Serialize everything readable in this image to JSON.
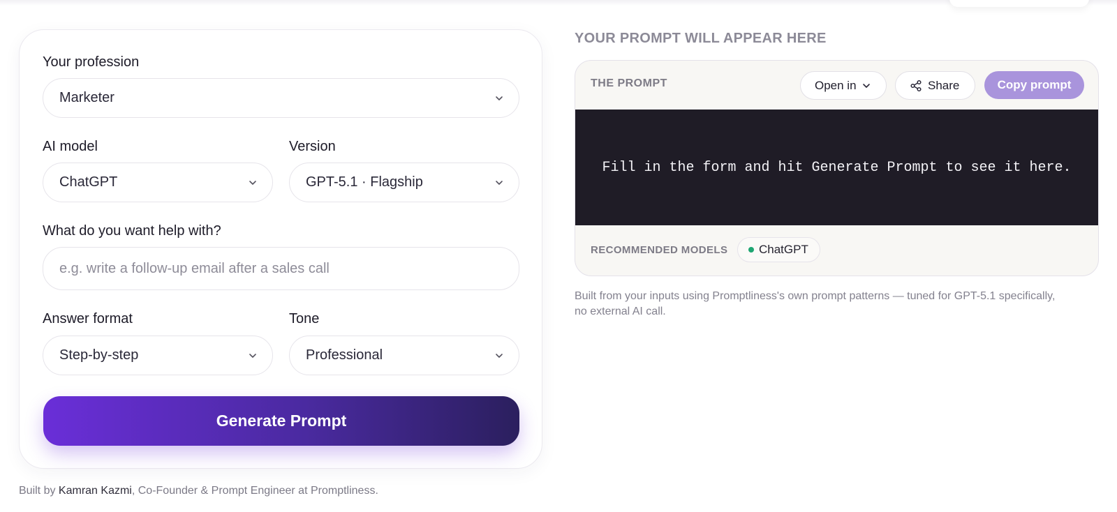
{
  "form": {
    "profession": {
      "label": "Your profession",
      "value": "Marketer"
    },
    "ai_model": {
      "label": "AI model",
      "value": "ChatGPT"
    },
    "version": {
      "label": "Version",
      "value": "GPT-5.1 · Flagship"
    },
    "help_with": {
      "label": "What do you want help with?",
      "placeholder": "e.g. write a follow-up email after a sales call",
      "value": ""
    },
    "answer_format": {
      "label": "Answer format",
      "value": "Step-by-step"
    },
    "tone": {
      "label": "Tone",
      "value": "Professional"
    },
    "generate_label": "Generate Prompt"
  },
  "footer": {
    "prefix": "Built by ",
    "author": "Kamran Kazmi",
    "suffix": ", Co-Founder & Prompt Engineer at Promptliness."
  },
  "output": {
    "heading": "YOUR PROMPT WILL APPEAR HERE",
    "card_title": "THE PROMPT",
    "open_in_label": "Open in",
    "share_label": "Share",
    "copy_label": "Copy prompt",
    "placeholder_text": "Fill in the form and hit Generate Prompt to see it here.",
    "recommended_label": "RECOMMENDED MODELS",
    "recommended_models": [
      "ChatGPT"
    ],
    "note": "Built from your inputs using Promptliness's own prompt patterns — tuned for GPT-5.1 specifically, no external AI call."
  },
  "colors": {
    "accent_start": "#6a2ed8",
    "accent_end": "#2b1f5e",
    "copy_button": "#a994dc",
    "code_background": "#1f1c26",
    "model_dot": "#1ea672"
  },
  "icons": {
    "select_chevron": "chevron-down-icon",
    "share": "share-icon"
  }
}
